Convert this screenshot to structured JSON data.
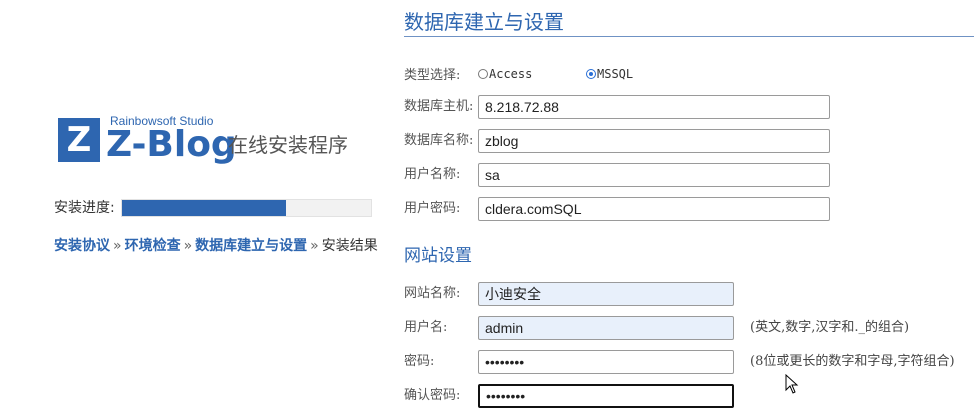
{
  "logo": {
    "studio": "Rainbowsoft Studio",
    "mark": "Z",
    "brand": "Z-Blog",
    "subtitle": "在线安装程序"
  },
  "progress": {
    "label": "安装进度:",
    "value": 0.66,
    "color": "#2e66b0"
  },
  "steps": [
    {
      "label": "安装协议",
      "state": "done"
    },
    {
      "label": "环境检查",
      "state": "done"
    },
    {
      "label": "数据库建立与设置",
      "state": "current-link"
    },
    {
      "label": "安装结果",
      "state": "pending"
    }
  ],
  "step_separator": "»",
  "database": {
    "title": "数据库建立与设置",
    "type_label": "类型选择:",
    "type_options": [
      {
        "label": "Access",
        "selected": false
      },
      {
        "label": "MSSQL",
        "selected": true
      }
    ],
    "host_label": "数据库主机:",
    "host_value": "8.218.72.88",
    "name_label": "数据库名称:",
    "name_value": "zblog",
    "user_label": "用户名称:",
    "user_value": "sa",
    "password_label": "用户密码:",
    "password_value": "cldera.comSQL"
  },
  "site": {
    "title": "网站设置",
    "site_name_label": "网站名称:",
    "site_name_value": "小迪安全",
    "username_label": "用户名:",
    "username_value": "admin",
    "username_hint": "(英文,数字,汉字和._的组合)",
    "password_label": "密码:",
    "password_value": "••••••••",
    "password_hint": "(8位或更长的数字和字母,字符组合)",
    "confirm_label": "确认密码:",
    "confirm_value": "••••••••"
  },
  "colors": {
    "accent": "#2e66b0",
    "autofill_bg": "#e8f0fb"
  }
}
